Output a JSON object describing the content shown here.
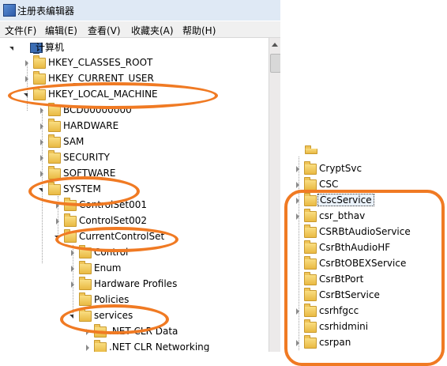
{
  "window": {
    "title": "注册表编辑器",
    "menu": [
      "文件(F)",
      "编辑(E)",
      "查看(V)",
      "收藏夹(A)",
      "帮助(H)"
    ]
  },
  "tree": {
    "root": "计算机",
    "hkcr": "HKEY_CLASSES_ROOT",
    "hkcu": "HKEY_CURRENT_USER",
    "hklm": "HKEY_LOCAL_MACHINE",
    "hklm_children": [
      "BCD00000000",
      "HARDWARE",
      "SAM",
      "SECURITY",
      "SOFTWARE",
      "SYSTEM"
    ],
    "system_children": [
      "ControlSet001",
      "ControlSet002",
      "CurrentControlSet"
    ],
    "ccs_children": [
      "Control",
      "Enum",
      "Hardware Profiles",
      "Policies",
      "services"
    ],
    "services_children": [
      ".NET CLR Data",
      ".NET CLR Networking"
    ]
  },
  "right_list": {
    "items": [
      "CryptSvc",
      "CSC",
      "CscService",
      "csr_bthav",
      "CSRBtAudioService",
      "CsrBthAudioHF",
      "CsrBtOBEXService",
      "CsrBtPort",
      "CsrBtService",
      "csrhfgcc",
      "csrhidmini",
      "csrpan"
    ],
    "selected": "CscService"
  },
  "colors": {
    "annotation": "#f07a23",
    "folder": "#e9b943",
    "titlebar": "#dfe9f5"
  }
}
